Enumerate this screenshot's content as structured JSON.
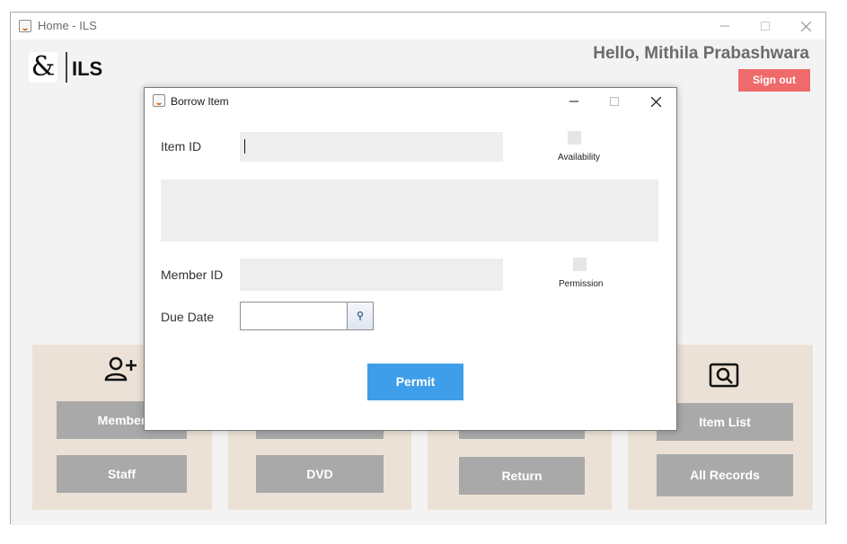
{
  "main_window": {
    "title": "Home - ILS",
    "logo_glyph": "&",
    "logo_text": "ILS",
    "greeting": "Hello, Mithila Prabashwara",
    "sign_out_label": "Sign out",
    "accent_sign_out": "#ef6b6b",
    "panels": [
      {
        "icon": "add-user-icon",
        "buttons": [
          "Member",
          "Staff"
        ]
      },
      {
        "icon": "",
        "buttons": [
          "",
          "DVD"
        ]
      },
      {
        "icon": "",
        "buttons": [
          "",
          "Return"
        ]
      },
      {
        "icon": "search-icon",
        "buttons": [
          "Item List",
          "All Records"
        ]
      }
    ]
  },
  "dialog": {
    "title": "Borrow Item",
    "item_id_label": "Item ID",
    "item_id_value": "",
    "availability_label": "Availability",
    "availability_checked": false,
    "member_id_label": "Member ID",
    "member_id_value": "",
    "permission_label": "Permission",
    "permission_checked": false,
    "due_date_label": "Due Date",
    "due_date_value": "",
    "permit_label": "Permit",
    "accent_permit": "#3e9ee9"
  }
}
